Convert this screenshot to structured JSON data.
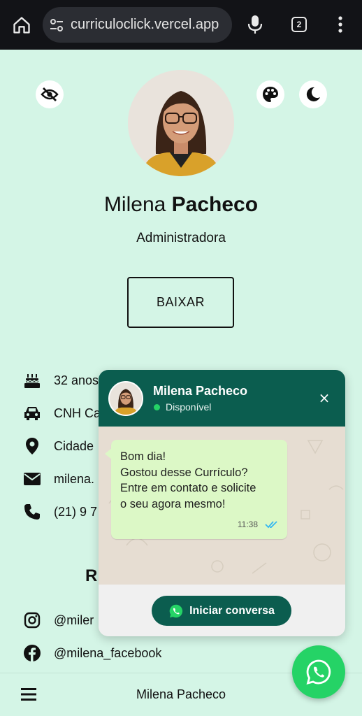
{
  "browser": {
    "url": "curriculoclick.vercel.app",
    "tab_count": "2"
  },
  "profile": {
    "first_name": "Milena",
    "last_name": "Pacheco",
    "role": "Administradora",
    "download_label": "BAIXAR"
  },
  "info": [
    {
      "icon": "cake-icon",
      "text": "32 anos"
    },
    {
      "icon": "car-icon",
      "text": "CNH Ca"
    },
    {
      "icon": "location-icon",
      "text": "Cidade"
    },
    {
      "icon": "email-icon",
      "text": "milena."
    },
    {
      "icon": "phone-icon",
      "text": "(21) 9 7"
    }
  ],
  "section_letter": "R",
  "social": [
    {
      "icon": "instagram-icon",
      "text": "@miler"
    },
    {
      "icon": "facebook-icon",
      "text": "@milena_facebook"
    }
  ],
  "chat": {
    "name": "Milena Pacheco",
    "status": "Disponível",
    "close": "×",
    "message_lines": [
      "Bom dia!",
      "Gostou desse Currículo?",
      "Entre em contato e solicite",
      "o seu agora mesmo!"
    ],
    "time": "11:38",
    "start_label": "Iniciar conversa"
  },
  "bottom_nav": {
    "title": "Milena Pacheco"
  },
  "colors": {
    "page_bg": "#d4f5e6",
    "chat_header": "#0b5d4f",
    "whatsapp_green": "#25d366",
    "bubble": "#dcf8c6"
  }
}
